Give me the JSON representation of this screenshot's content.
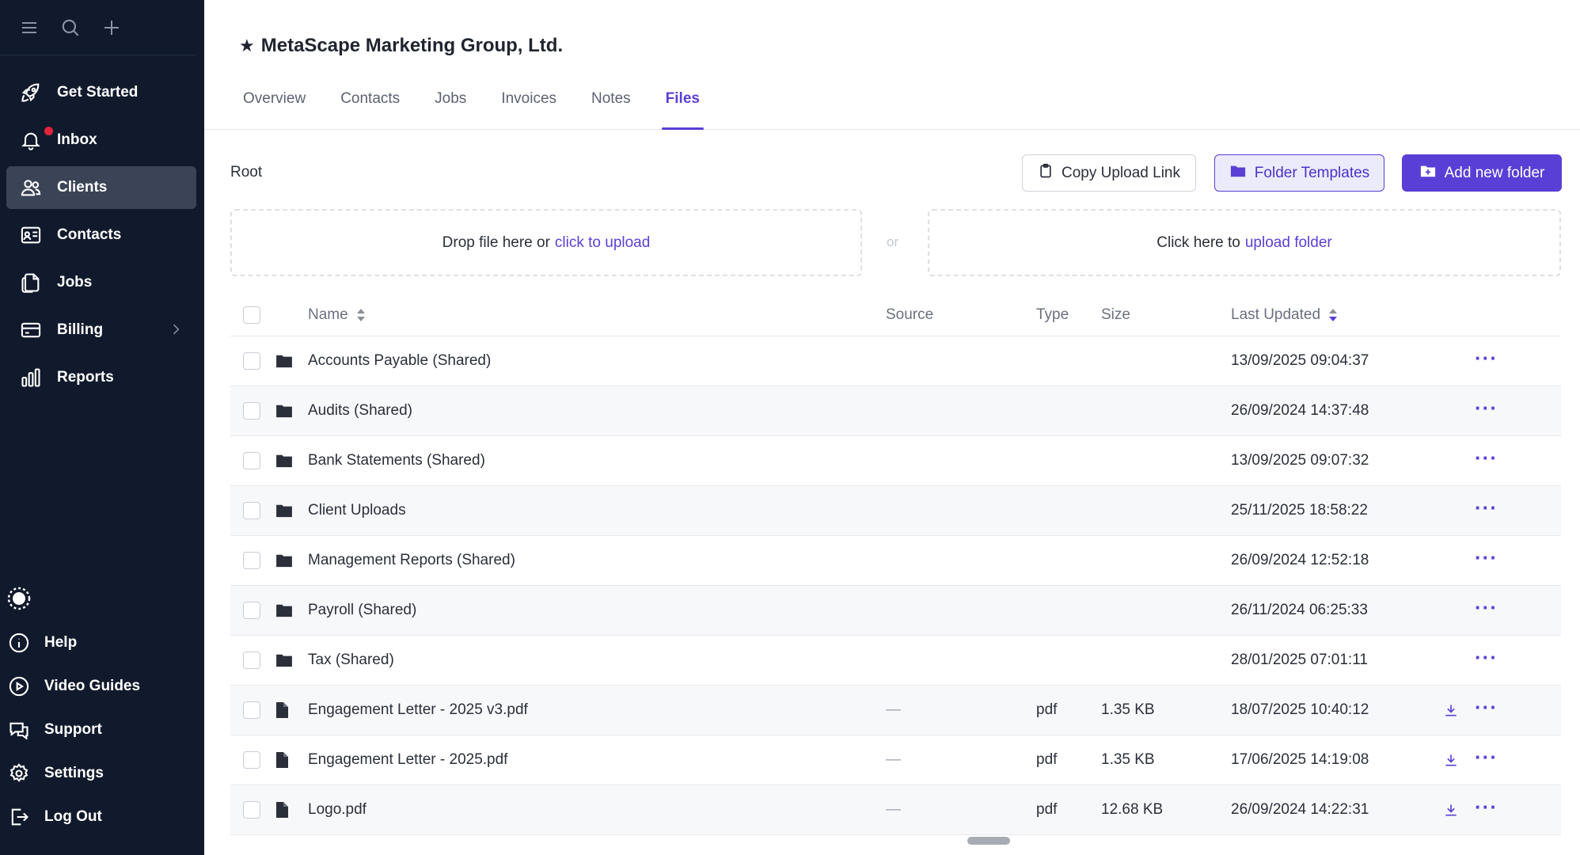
{
  "sidebar": {
    "top_icons": [
      "menu-icon",
      "search-icon",
      "plus-icon"
    ],
    "nav": [
      {
        "label": "Get Started",
        "icon": "rocket-icon"
      },
      {
        "label": "Inbox",
        "icon": "bell-icon",
        "notification_dot": true
      },
      {
        "label": "Clients",
        "icon": "users-icon",
        "active": true
      },
      {
        "label": "Contacts",
        "icon": "contact-card-icon"
      },
      {
        "label": "Jobs",
        "icon": "documents-icon"
      },
      {
        "label": "Billing",
        "icon": "credit-card-icon",
        "has_submenu": true
      },
      {
        "label": "Reports",
        "icon": "bar-chart-icon"
      }
    ],
    "bottom": [
      {
        "label": "Help",
        "icon": "info-icon"
      },
      {
        "label": "Video Guides",
        "icon": "play-icon"
      },
      {
        "label": "Support",
        "icon": "chat-icon"
      },
      {
        "label": "Settings",
        "icon": "gear-icon"
      },
      {
        "label": "Log Out",
        "icon": "logout-icon"
      }
    ]
  },
  "header": {
    "title": "MetaScape Marketing Group, Ltd.",
    "tabs": [
      {
        "label": "Overview"
      },
      {
        "label": "Contacts"
      },
      {
        "label": "Jobs"
      },
      {
        "label": "Invoices"
      },
      {
        "label": "Notes"
      },
      {
        "label": "Files",
        "active": true
      }
    ]
  },
  "toolbar": {
    "breadcrumb": "Root",
    "copy_upload_link": "Copy Upload Link",
    "folder_templates": "Folder Templates",
    "add_new_folder": "Add new folder"
  },
  "upload": {
    "file_text": "Drop file here or",
    "file_link": "click to upload",
    "or": "or",
    "folder_text": "Click here to",
    "folder_link": "upload folder"
  },
  "table": {
    "columns": {
      "name": "Name",
      "source": "Source",
      "type": "Type",
      "size": "Size",
      "last_updated": "Last Updated"
    },
    "rows": [
      {
        "kind": "folder",
        "name": "Accounts Payable (Shared)",
        "source": "",
        "type": "",
        "size": "",
        "updated": "13/09/2025 09:04:37"
      },
      {
        "kind": "folder",
        "name": "Audits (Shared)",
        "source": "",
        "type": "",
        "size": "",
        "updated": "26/09/2024 14:37:48"
      },
      {
        "kind": "folder",
        "name": "Bank Statements (Shared)",
        "source": "",
        "type": "",
        "size": "",
        "updated": "13/09/2025 09:07:32"
      },
      {
        "kind": "folder",
        "name": "Client Uploads",
        "source": "",
        "type": "",
        "size": "",
        "updated": "25/11/2025 18:58:22"
      },
      {
        "kind": "folder",
        "name": "Management Reports (Shared)",
        "source": "",
        "type": "",
        "size": "",
        "updated": "26/09/2024 12:52:18"
      },
      {
        "kind": "folder",
        "name": "Payroll (Shared)",
        "source": "",
        "type": "",
        "size": "",
        "updated": "26/11/2024 06:25:33"
      },
      {
        "kind": "folder",
        "name": "Tax (Shared)",
        "source": "",
        "type": "",
        "size": "",
        "updated": "28/01/2025 07:01:11"
      },
      {
        "kind": "file",
        "name": "Engagement Letter - 2025 v3.pdf",
        "source": "—",
        "type": "pdf",
        "size": "1.35 KB",
        "updated": "18/07/2025 10:40:12"
      },
      {
        "kind": "file",
        "name": "Engagement Letter - 2025.pdf",
        "source": "—",
        "type": "pdf",
        "size": "1.35 KB",
        "updated": "17/06/2025 14:19:08"
      },
      {
        "kind": "file",
        "name": "Logo.pdf",
        "source": "—",
        "type": "pdf",
        "size": "12.68 KB",
        "updated": "26/09/2024 14:22:31"
      }
    ],
    "more_label": "···"
  },
  "colors": {
    "accent": "#5a3fd6",
    "sidebar_bg": "#111a2c",
    "notification": "#e0243a"
  }
}
